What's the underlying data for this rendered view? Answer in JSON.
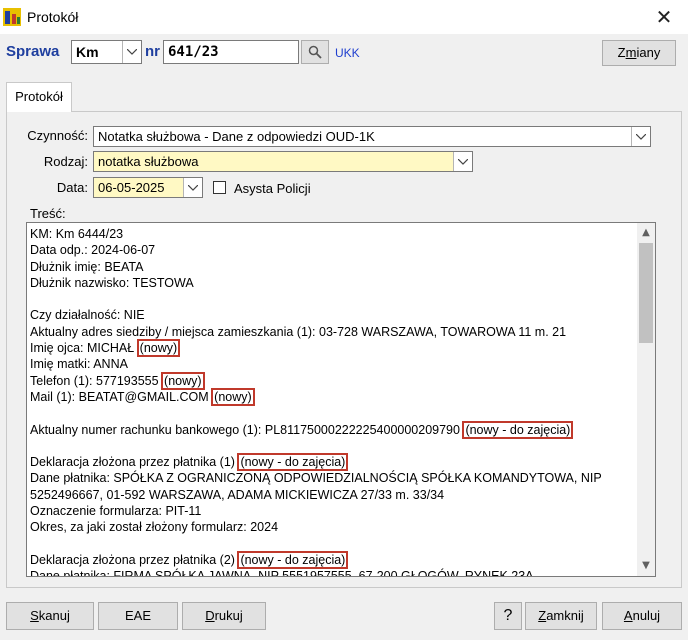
{
  "window": {
    "title": "Protokół"
  },
  "header": {
    "sprawa_label": "Sprawa",
    "typ_value": "Km",
    "nr_label": "nr",
    "nr_value": "641/23",
    "ukk_link": "UKK",
    "zmiany_pre": "Z",
    "zmiany_u": "m",
    "zmiany_post": "iany"
  },
  "tabs": [
    {
      "label": "Protokół"
    }
  ],
  "form": {
    "czynnosc_label": "Czynność:",
    "czynnosc_value": "Notatka służbowa - Dane z odpowiedzi OUD-1K",
    "rodzaj_label": "Rodzaj:",
    "rodzaj_value": "notatka służbowa",
    "data_label": "Data:",
    "data_value": "06-05-2025",
    "asysta_label": "Asysta Policji",
    "tresc_label": "Treść:",
    "highlight_color": "#fff9c4"
  },
  "content": {
    "lines": [
      {
        "text": "KM: Km 6444/23",
        "tag": ""
      },
      {
        "text": "Data odp.: 2024-06-07",
        "tag": ""
      },
      {
        "text": "Dłużnik imię: BEATA",
        "tag": ""
      },
      {
        "text": "Dłużnik nazwisko: TESTOWA",
        "tag": ""
      },
      {
        "text": "",
        "tag": ""
      },
      {
        "text": "Czy działalność: NIE",
        "tag": ""
      },
      {
        "text": "Aktualny adres siedziby / miejsca zamieszkania (1): 03-728 WARSZAWA, TOWAROWA 11 m. 21",
        "tag": ""
      },
      {
        "text": "Imię ojca: MICHAŁ ",
        "tag": "(nowy)"
      },
      {
        "text": "Imię matki: ANNA",
        "tag": ""
      },
      {
        "text": "Telefon (1): 577193555 ",
        "tag": "(nowy)"
      },
      {
        "text": "Mail (1): BEATAT@GMAIL.COM ",
        "tag": "(nowy)"
      },
      {
        "text": "",
        "tag": ""
      },
      {
        "text": "Aktualny numer rachunku bankowego (1): PL81175000222225400000209790 ",
        "tag": "(nowy - do zajęcia)"
      },
      {
        "text": "",
        "tag": ""
      },
      {
        "text": "Deklaracja złożona przez płatnika (1) ",
        "tag": "(nowy - do zajęcia)"
      },
      {
        "text": "Dane płatnika: SPÓŁKA Z OGRANICZONĄ ODPOWIEDZIALNOŚCIĄ SPÓŁKA KOMANDYTOWA, NIP",
        "tag": ""
      },
      {
        "text": "5252496667, 01-592 WARSZAWA, ADAMA MICKIEWICZA 27/33 m. 33/34",
        "tag": ""
      },
      {
        "text": "Oznaczenie formularza: PIT-11",
        "tag": ""
      },
      {
        "text": "Okres, za jaki został złożony formularz: 2024",
        "tag": ""
      },
      {
        "text": "",
        "tag": ""
      },
      {
        "text": "Deklaracja złożona przez płatnika (2) ",
        "tag": "(nowy - do zajęcia)"
      },
      {
        "text": "Dane płatnika: FIRMA SPÓŁKA JAWNA, NIP 5551957555, 67-200 GŁOGÓW, RYNEK 23A",
        "tag": ""
      }
    ]
  },
  "footer": {
    "skanuj_pre": "",
    "skanuj_u": "S",
    "skanuj_post": "kanuj",
    "eae": "EAE",
    "drukuj_pre": "",
    "drukuj_u": "D",
    "drukuj_post": "rukuj",
    "help": "?",
    "zamknij_pre": "",
    "zamknij_u": "Z",
    "zamknij_post": "amknij",
    "anuluj_pre": "",
    "anuluj_u": "A",
    "anuluj_post": "nuluj"
  }
}
